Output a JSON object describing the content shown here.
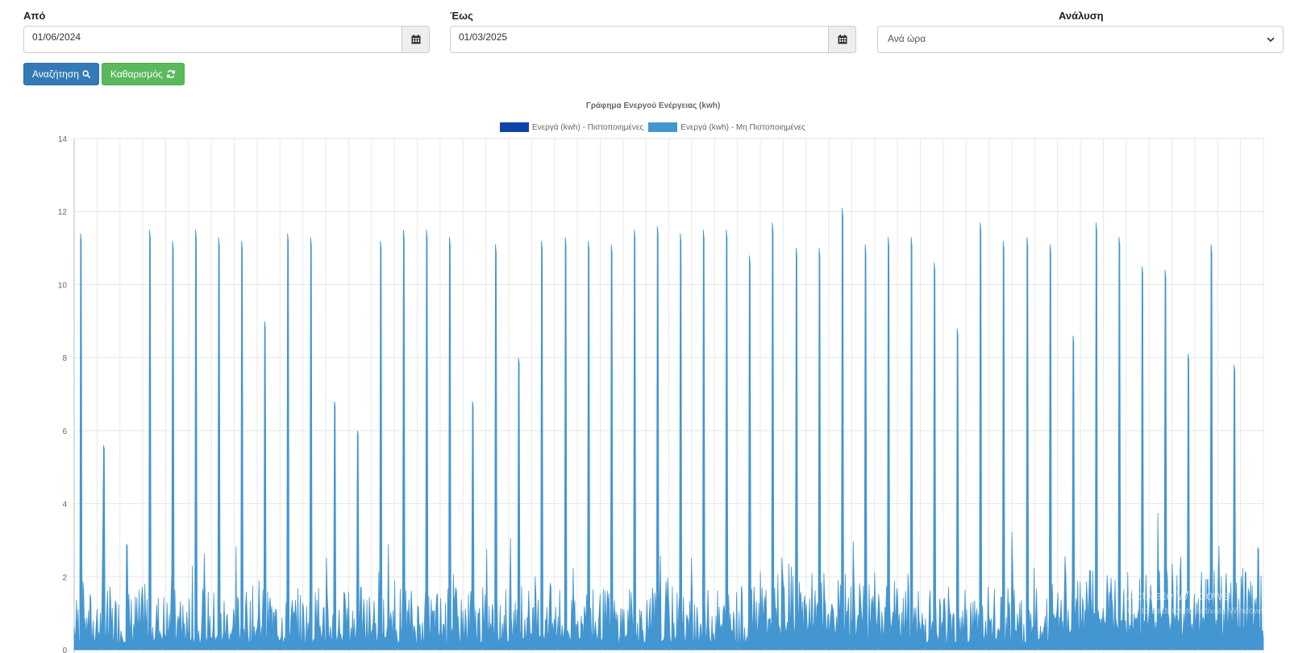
{
  "form": {
    "from_label": "Από",
    "from_value": "01/06/2024",
    "to_label": "Έως",
    "to_value": "01/03/2025",
    "analysis_label": "Ανάλυση",
    "analysis_value": "Ανά ώρα"
  },
  "buttons": {
    "search_label": "Αναζήτηση",
    "reset_label": "Καθαρισμός"
  },
  "icons": {
    "calendar": "calendar-icon",
    "search": "search-icon",
    "refresh": "refresh-icon",
    "chevron": "chevron-down-icon"
  },
  "colors": {
    "search_button": "#337ab7",
    "reset_button": "#5cb85c",
    "series_certified": "#1142a8",
    "series_uncertified": "#4496d0"
  },
  "chart_data": {
    "type": "area",
    "title": "Γράφημα Ενεργού Ενέργειας (kwh)",
    "legend_position": "top",
    "grid": true,
    "ylim": [
      0,
      14
    ],
    "yticks": [
      "0",
      "2",
      "4",
      "6",
      "8",
      "10",
      "12",
      "14"
    ],
    "series": [
      {
        "name": "Ενεργά (kwh) - Πιστοποιημένες",
        "values": []
      },
      {
        "name": "Ενεργά (kwh) - Μη Πιστοποιημένες",
        "peaks": [
          11.4,
          5.6,
          2.9,
          11.5,
          11.2,
          11.5,
          11.3,
          11.2,
          9.0,
          11.4,
          11.3,
          6.8,
          6.0,
          11.2,
          11.5,
          11.5,
          11.3,
          6.8,
          11.1,
          8.0,
          11.2,
          11.3,
          11.2,
          11.1,
          11.5,
          11.6,
          11.4,
          11.5,
          11.5,
          10.8,
          11.7,
          11.0,
          11.0,
          12.1,
          11.1,
          11.3,
          11.3,
          10.6,
          8.8,
          11.7,
          11.2,
          11.3,
          11.1,
          8.6,
          11.7,
          11.3,
          10.5,
          10.4,
          8.1,
          11.1,
          7.8,
          2.8
        ],
        "baseline_range": [
          0.2,
          1.5
        ]
      }
    ]
  },
  "watermark": {
    "line1": "Activate Windows",
    "line2": "Go to Settings to activate Windows."
  }
}
